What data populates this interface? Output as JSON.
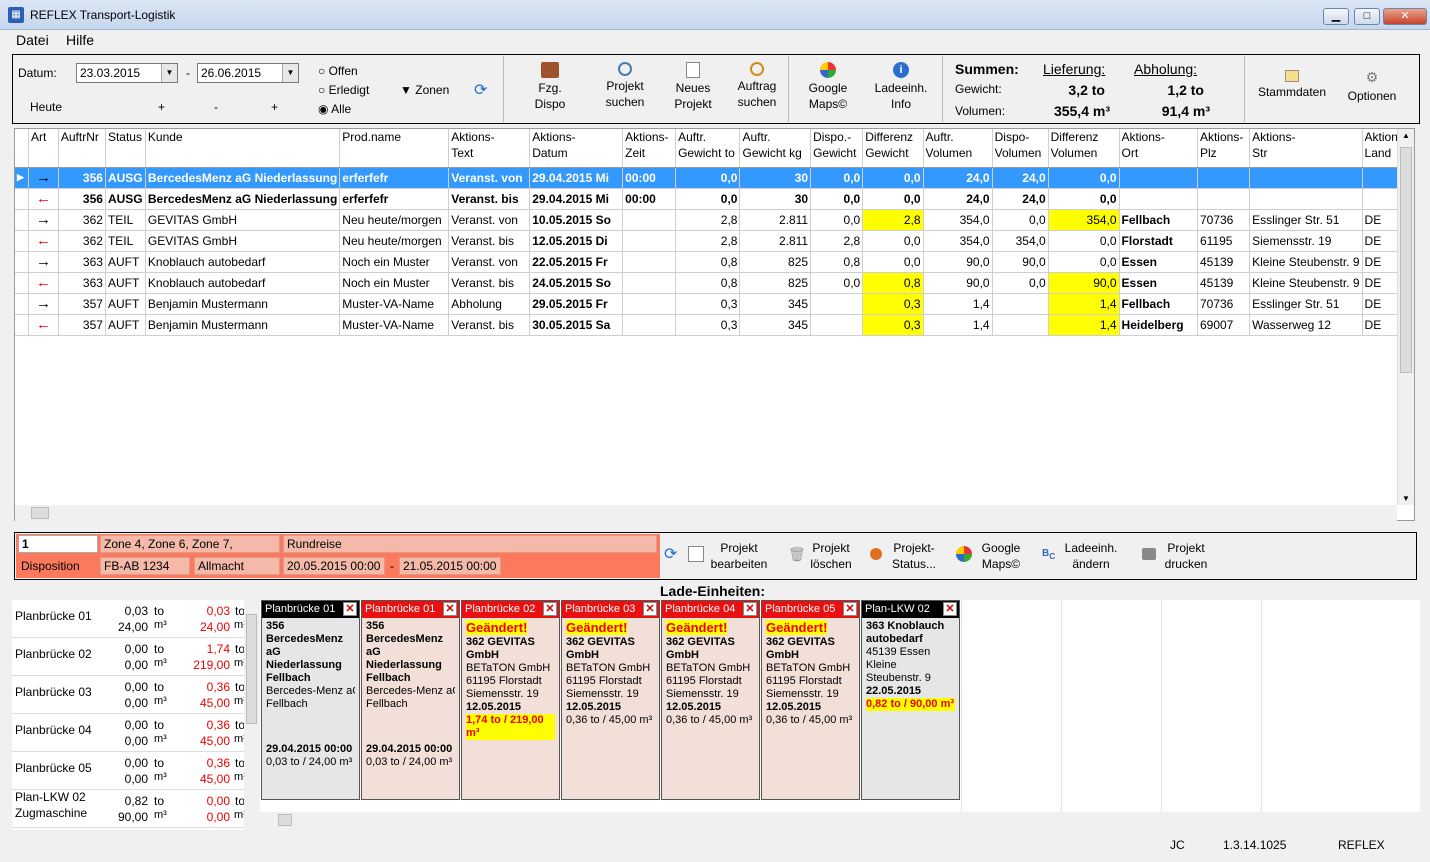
{
  "window": {
    "title": "REFLEX Transport-Logistik",
    "min": "▁",
    "max": "□",
    "close": "✕"
  },
  "menu": [
    "Datei",
    "Hilfe"
  ],
  "filter": {
    "datum_label": "Datum:",
    "date_from": "23.03.2015",
    "date_to": "26.06.2015",
    "dash": "-",
    "heute": "Heute",
    "plus1": "+",
    "minus": "-",
    "plus2": "+",
    "radio_offen": "Offen",
    "radio_erledigt": "Erledigt",
    "radio_alle": "Alle",
    "zonen": "Zonen"
  },
  "toolbar": {
    "fzg": "Fzg.\nDispo",
    "projekt_suchen": "Projekt\nsuchen",
    "neues_projekt": "Neues\nProjekt",
    "auftrag_suchen": "Auftrag\nsuchen",
    "google_maps": "Google\nMaps©",
    "ladeeinh_info": "Ladeeinh.\nInfo",
    "stammdaten": "Stammdaten",
    "optionen": "Optionen"
  },
  "summen": {
    "title": "Summen:",
    "gewicht_label": "Gewicht:",
    "volumen_label": "Volumen:",
    "lieferung_label": "Lieferung:",
    "abholung_label": "Abholung:",
    "lief_gewicht": "3,2 to",
    "lief_volumen": "355,4 m³",
    "abh_gewicht": "1,2 to",
    "abh_volumen": "91,4 m³"
  },
  "grid": {
    "columns": [
      "Art",
      "AuftrNr",
      "Status",
      "Kunde",
      "Prod.name",
      "Aktions-\nText",
      "Aktions-\nDatum",
      "Aktions-\nZeit",
      "Auftr.\nGewicht to",
      "Auftr.\nGewicht kg",
      "Dispo.-\nGewicht",
      "Differenz\nGewicht",
      "Auftr.\nVolumen",
      "Dispo-\nVolumen",
      "Differenz\nVolumen",
      "Aktions-\nOrt",
      "Aktions-\nPlz",
      "Aktions-\nStr",
      "Aktions-\nLand"
    ],
    "rows": [
      [
        "→",
        "356",
        "AUSG",
        "BercedesMenz aG Niederlassung",
        "erferfefr",
        "Veranst. von",
        "29.04.2015 Mi",
        "00:00",
        "0,0",
        "30",
        "0,0",
        "0,0",
        "24,0",
        "24,0",
        "0,0",
        "",
        "",
        "",
        ""
      ],
      [
        "←",
        "356",
        "AUSG",
        "BercedesMenz aG Niederlassung",
        "erferfefr",
        "Veranst. bis",
        "29.04.2015 Mi",
        "00:00",
        "0,0",
        "30",
        "0,0",
        "0,0",
        "24,0",
        "24,0",
        "0,0",
        "",
        "",
        "",
        ""
      ],
      [
        "→",
        "362",
        "TEIL",
        "GEVITAS GmbH",
        "Neu heute/morgen",
        "Veranst. von",
        "10.05.2015 So",
        "",
        "2,8",
        "2.811",
        "0,0",
        "2,8",
        "354,0",
        "0,0",
        "354,0",
        "Fellbach",
        "70736",
        "Esslinger Str. 51",
        "DE"
      ],
      [
        "←",
        "362",
        "TEIL",
        "GEVITAS GmbH",
        "Neu heute/morgen",
        "Veranst. bis",
        "12.05.2015 Di",
        "",
        "2,8",
        "2.811",
        "2,8",
        "0,0",
        "354,0",
        "354,0",
        "0,0",
        "Florstadt",
        "61195",
        "Siemensstr. 19",
        "DE"
      ],
      [
        "→",
        "363",
        "AUFT",
        "Knoblauch autobedarf",
        "Noch ein Muster",
        "Veranst. von",
        "22.05.2015 Fr",
        "",
        "0,8",
        "825",
        "0,8",
        "0,0",
        "90,0",
        "90,0",
        "0,0",
        "Essen",
        "45139",
        "Kleine Steubenstr. 9",
        "DE"
      ],
      [
        "←",
        "363",
        "AUFT",
        "Knoblauch autobedarf",
        "Noch ein Muster",
        "Veranst. bis",
        "24.05.2015 So",
        "",
        "0,8",
        "825",
        "0,0",
        "0,8",
        "90,0",
        "0,0",
        "90,0",
        "Essen",
        "45139",
        "Kleine Steubenstr. 9",
        "DE"
      ],
      [
        "→",
        "357",
        "AUFT",
        "Benjamin Mustermann",
        "Muster-VA-Name",
        "Abholung",
        "29.05.2015 Fr",
        "",
        "0,3",
        "345",
        "",
        "0,3",
        "1,4",
        "",
        "1,4",
        "Fellbach",
        "70736",
        "Esslinger Str. 51",
        "DE"
      ],
      [
        "←",
        "357",
        "AUFT",
        "Benjamin Mustermann",
        "Muster-VA-Name",
        "Veranst. bis",
        "30.05.2015 Sa",
        "",
        "0,3",
        "345",
        "",
        "0,3",
        "1,4",
        "",
        "1,4",
        "Heidelberg",
        "69007",
        "Wasserweg 12",
        "DE"
      ]
    ]
  },
  "disposition": {
    "nr": "1",
    "label": "Disposition",
    "zonen": "Zone 4, Zone 6, Zone 7,",
    "kennzeichen": "FB-AB 1234",
    "firma": "Allmacht",
    "typ": "Rundreise",
    "von": "20.05.2015 00:00",
    "dash": "-",
    "bis": "21.05.2015 00:00",
    "buttons": {
      "bearbeiten": "Projekt\nbearbeiten",
      "loeschen": "Projekt\nlöschen",
      "status": "Projekt-\nStatus...",
      "maps": "Google\nMaps©",
      "ladeeinh": "Ladeeinh.\nändern",
      "drucken": "Projekt\ndrucken"
    }
  },
  "lade_title": "Lade-Einheiten:",
  "planlist": [
    {
      "name": "Planbrücke 01",
      "sub": "",
      "w1": "0,03",
      "w2": "0,03",
      "v1": "24,00",
      "v2": "24,00"
    },
    {
      "name": "Planbrücke 02",
      "sub": "",
      "w1": "0,00",
      "w2": "1,74",
      "v1": "0,00",
      "v2": "219,00"
    },
    {
      "name": "Planbrücke 03",
      "sub": "",
      "w1": "0,00",
      "w2": "0,36",
      "v1": "0,00",
      "v2": "45,00"
    },
    {
      "name": "Planbrücke 04",
      "sub": "",
      "w1": "0,00",
      "w2": "0,36",
      "v1": "0,00",
      "v2": "45,00"
    },
    {
      "name": "Planbrücke 05",
      "sub": "",
      "w1": "0,00",
      "w2": "0,36",
      "v1": "0,00",
      "v2": "45,00"
    },
    {
      "name": "Plan-LKW 02",
      "sub": "Zugmaschine",
      "w1": "0,82",
      "w2": "0,00",
      "v1": "90,00",
      "v2": "0,00"
    }
  ],
  "units": {
    "to": "to",
    "m3": "m³"
  },
  "cards": [
    {
      "head": "Planbrücke 01",
      "headColor": "#000000",
      "changed": "",
      "lines": [
        "356",
        "BercedesMenz",
        "aG",
        "Niederlassung",
        "Fellbach"
      ],
      "plain": [
        "Bercedes-Menz aG",
        "Fellbach"
      ],
      "date": "29.04.2015 00:00",
      "sum": "0,03 to / 24,00 m³",
      "hl": ""
    },
    {
      "head": "Planbrücke 01",
      "headColor": "#e81010",
      "changed": "",
      "lines": [
        "356",
        "BercedesMenz",
        "aG",
        "Niederlassung",
        "Fellbach"
      ],
      "plain": [
        "Bercedes-Menz aG",
        "Fellbach"
      ],
      "date": "29.04.2015 00:00",
      "sum": "0,03 to / 24,00 m³",
      "hl": ""
    },
    {
      "head": "Planbrücke 02",
      "headColor": "#e81010",
      "changed": "Geändert!",
      "lines": [
        "362 GEVITAS",
        "GmbH"
      ],
      "plain": [
        "BETaTON GmbH",
        "61195 Florstadt",
        "Siemensstr. 19"
      ],
      "date": "12.05.2015",
      "sum": "",
      "hl": "1,74 to / 219,00 m³"
    },
    {
      "head": "Planbrücke 03",
      "headColor": "#e81010",
      "changed": "Geändert!",
      "lines": [
        "362 GEVITAS",
        "GmbH"
      ],
      "plain": [
        "BETaTON GmbH",
        "61195 Florstadt",
        "Siemensstr. 19"
      ],
      "date": "12.05.2015",
      "sum": "0,36 to / 45,00 m³",
      "hl": ""
    },
    {
      "head": "Planbrücke 04",
      "headColor": "#e81010",
      "changed": "Geändert!",
      "lines": [
        "362 GEVITAS",
        "GmbH"
      ],
      "plain": [
        "BETaTON GmbH",
        "61195 Florstadt",
        "Siemensstr. 19"
      ],
      "date": "12.05.2015",
      "sum": "0,36 to / 45,00 m³",
      "hl": ""
    },
    {
      "head": "Planbrücke 05",
      "headColor": "#e81010",
      "changed": "Geändert!",
      "lines": [
        "362 GEVITAS",
        "GmbH"
      ],
      "plain": [
        "BETaTON GmbH",
        "61195 Florstadt",
        "Siemensstr. 19"
      ],
      "date": "12.05.2015",
      "sum": "0,36 to / 45,00 m³",
      "hl": ""
    },
    {
      "head": "Plan-LKW 02",
      "headColor": "#000000",
      "changed": "",
      "lines": [
        "363 Knoblauch",
        "autobedarf"
      ],
      "plain": [
        "45139 Essen",
        "Kleine",
        "Steubenstr. 9"
      ],
      "date": "22.05.2015",
      "sum": "",
      "hl": "0,82 to / 90,00 m³"
    }
  ],
  "status": {
    "user": "JC",
    "version": "1.3.14.1025",
    "app": "REFLEX"
  }
}
